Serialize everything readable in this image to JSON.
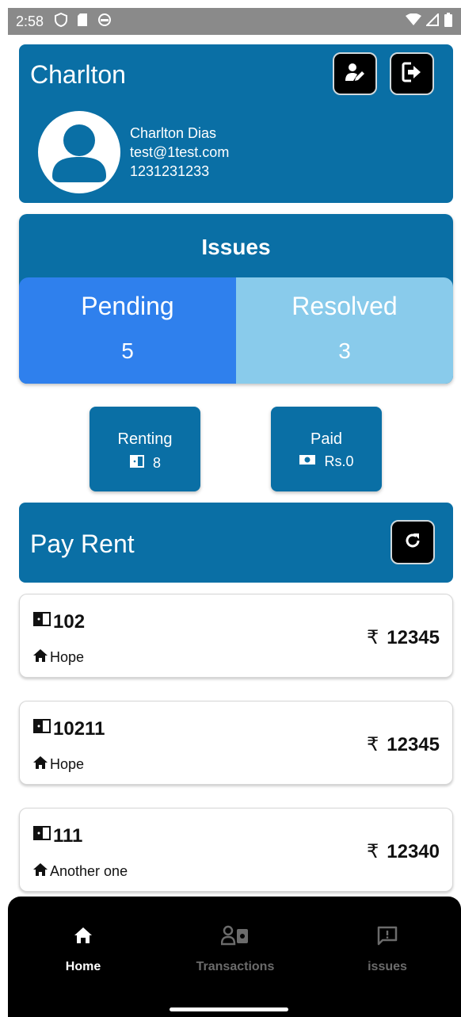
{
  "status_bar": {
    "time": "2:58"
  },
  "profile": {
    "title": "Charlton",
    "full_name": "Charlton Dias",
    "email": "test@1test.com",
    "phone": "1231231233"
  },
  "issues": {
    "title": "Issues",
    "pending_label": "Pending",
    "pending_count": "5",
    "resolved_label": "Resolved",
    "resolved_count": "3"
  },
  "stats": {
    "renting_label": "Renting",
    "renting_value": "8",
    "paid_label": "Paid",
    "paid_value": "Rs.0"
  },
  "pay_rent": {
    "title": "Pay Rent"
  },
  "rent_items": [
    {
      "room": "102",
      "property": "Hope",
      "currency": "₹",
      "amount": "12345"
    },
    {
      "room": "10211",
      "property": "Hope",
      "currency": "₹",
      "amount": "12345"
    },
    {
      "room": "111",
      "property": "Another one",
      "currency": "₹",
      "amount": "12340"
    }
  ],
  "nav": {
    "home": "Home",
    "transactions": "Transactions",
    "issues": "issues"
  },
  "colors": {
    "primary": "#0a6fa5",
    "pending": "#2f80ed",
    "resolved": "#89cbeb"
  }
}
